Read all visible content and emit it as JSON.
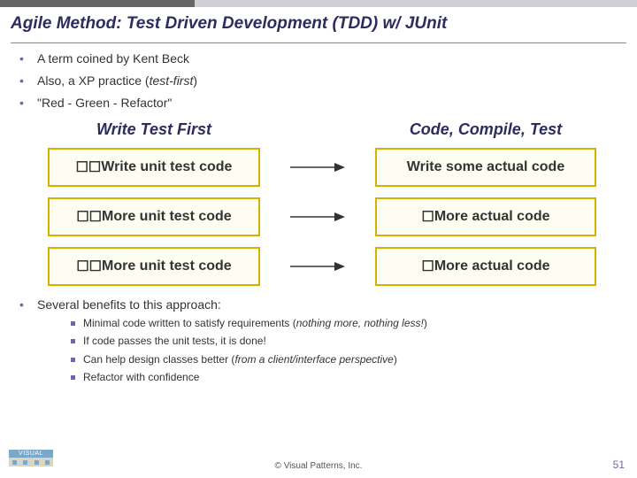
{
  "title": "Agile Method: Test Driven Development (TDD) w/ JUnit",
  "bullets": {
    "b1": "A term coined by Kent Beck",
    "b2a": "Also, a XP practice (",
    "b2b": "test-first",
    "b2c": ")",
    "b3": "\"Red - Green - Refactor\""
  },
  "columns": {
    "left": "Write Test First",
    "right": "Code, Compile, Test"
  },
  "rows": [
    {
      "left_prefix": "☐☐",
      "left": "Write unit test code",
      "right_prefix": "",
      "right": "Write some actual code"
    },
    {
      "left_prefix": "☐☐",
      "left": "More unit test code",
      "right_prefix": "☐",
      "right": "More actual code"
    },
    {
      "left_prefix": "☐☐",
      "left": "More unit test code",
      "right_prefix": "☐",
      "right": "More actual code"
    }
  ],
  "benefits_intro": "Several benefits to this approach:",
  "benefits": {
    "s1a": "Minimal code written to satisfy requirements (",
    "s1b": "nothing more, nothing less!",
    "s1c": ")",
    "s2": "If code passes the unit tests, it is done!",
    "s3a": "Can help design classes better (",
    "s3b": "from a client/interface perspective",
    "s3c": ")",
    "s4": "Refactor with confidence"
  },
  "footer": {
    "logo_top": "VISUAL",
    "copyright": "© Visual Patterns, Inc.",
    "page": "51"
  }
}
